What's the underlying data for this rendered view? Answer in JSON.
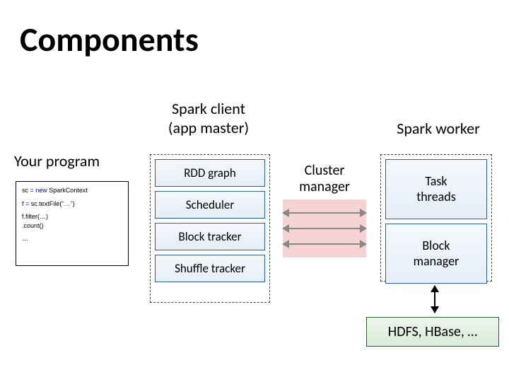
{
  "title": "Components",
  "labels": {
    "spark_client": "Spark client\n(app master)",
    "spark_worker": "Spark worker",
    "your_program": "Your program",
    "cluster_manager": "Cluster\nmanager"
  },
  "code": {
    "l1a": "sc ",
    "l1b": "= new ",
    "l1c": "SparkContext",
    "l2a": "f ",
    "l2b": "= sc.",
    "l2c": "textFile",
    "l2d": "(",
    "l2e": "\"…\"",
    "l2f": ")",
    "l3a": "f.",
    "l3b": "filter",
    "l3c": "(…)",
    "l4a": " .",
    "l4b": "count",
    "l4c": "()",
    "l5": "…"
  },
  "client": {
    "rdd": "RDD graph",
    "scheduler": "Scheduler",
    "block": "Block tracker",
    "shuffle": "Shuffle tracker"
  },
  "worker": {
    "task": "Task\nthreads",
    "block": "Block\nmanager"
  },
  "storage": "HDFS, HBase, …"
}
